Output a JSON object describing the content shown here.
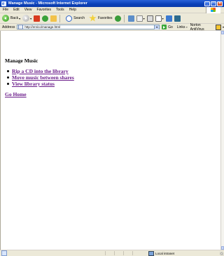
{
  "window": {
    "title": "Manage Music - Microsoft Internet Explorer",
    "buttons": {
      "minimize": "_",
      "maximize": "□",
      "close": "×"
    }
  },
  "menu": [
    "File",
    "Edit",
    "View",
    "Favorites",
    "Tools",
    "Help"
  ],
  "toolbar": {
    "back_label": "Back",
    "search_label": "Search",
    "favorites_label": "Favorites"
  },
  "address_bar": {
    "label": "Address",
    "url": "http://enrico/manage.html",
    "go_label": "Go",
    "links_label": "Links",
    "norton_label": "Norton AntiVirus"
  },
  "page": {
    "heading": "Manage Music",
    "links": [
      {
        "label": "Rip a CD into the library"
      },
      {
        "label": "Move music between shares"
      },
      {
        "label": "View library status"
      }
    ],
    "home_link": "Go Home"
  },
  "status_bar": {
    "zone": "Local intranet"
  },
  "colors": {
    "title_bar": "#0a3fb8",
    "chrome": "#ece9d8",
    "visited_link": "#6b1d8a"
  }
}
